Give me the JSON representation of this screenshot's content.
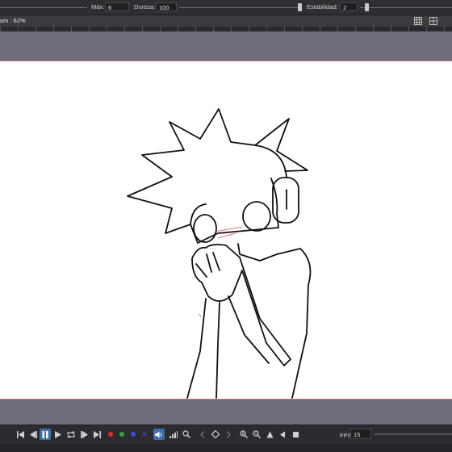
{
  "toolbar": {
    "max_label": "Máx:",
    "max_value": "6",
    "hardness_label": "Dureza:",
    "hardness_value": "100",
    "stability_label": "Estabilidad:",
    "stability_value": "2"
  },
  "zoom": {
    "label": "om : 62%"
  },
  "timeline": {
    "icons": [
      "first-frame-icon",
      "prev-frame-icon",
      "pause-icon",
      "play-icon",
      "loop-icon",
      "next-frame-icon",
      "last-frame-icon",
      "red-onion-icon",
      "green-onion-icon",
      "blue-onion-icon",
      "dark-onion-icon",
      "sound-icon",
      "waveform-icon",
      "magnify-icon",
      "prev-key-icon",
      "keyframe-icon",
      "next-key-icon",
      "zoom-in-icon",
      "zoom-out-icon",
      "flip-up-icon",
      "flip-icon",
      "stop-icon"
    ],
    "fps_label": "FPS",
    "fps_value": "15"
  },
  "colors": {
    "toolbar_bg": "#2f2f33",
    "canvas_bg": "#6c6c7a",
    "paper": "#ffffff",
    "active_button": "#3d6fa8",
    "onion_red": "#d33030",
    "onion_green": "#2fa840",
    "onion_blue": "#3050d0"
  }
}
